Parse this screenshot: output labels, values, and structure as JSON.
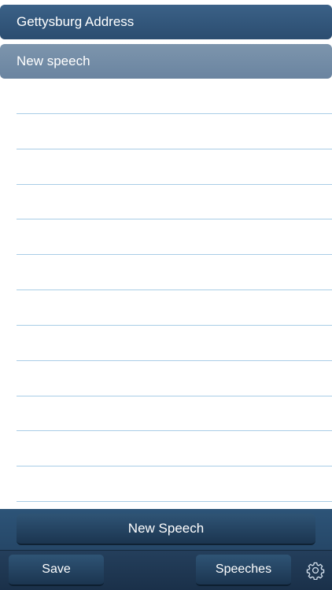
{
  "speeches": [
    {
      "label": "Gettysburg Address"
    },
    {
      "label": "New speech"
    }
  ],
  "actions": {
    "new_speech_label": "New Speech"
  },
  "toolbar": {
    "save_label": "Save",
    "speeches_label": "Speeches"
  },
  "icons": {
    "settings": "gear-icon"
  },
  "colors": {
    "header_dark": "#2b4d70",
    "header_selected": "#7089a3",
    "rule_line": "#a9cde6",
    "toolbar": "#1e3a57"
  }
}
